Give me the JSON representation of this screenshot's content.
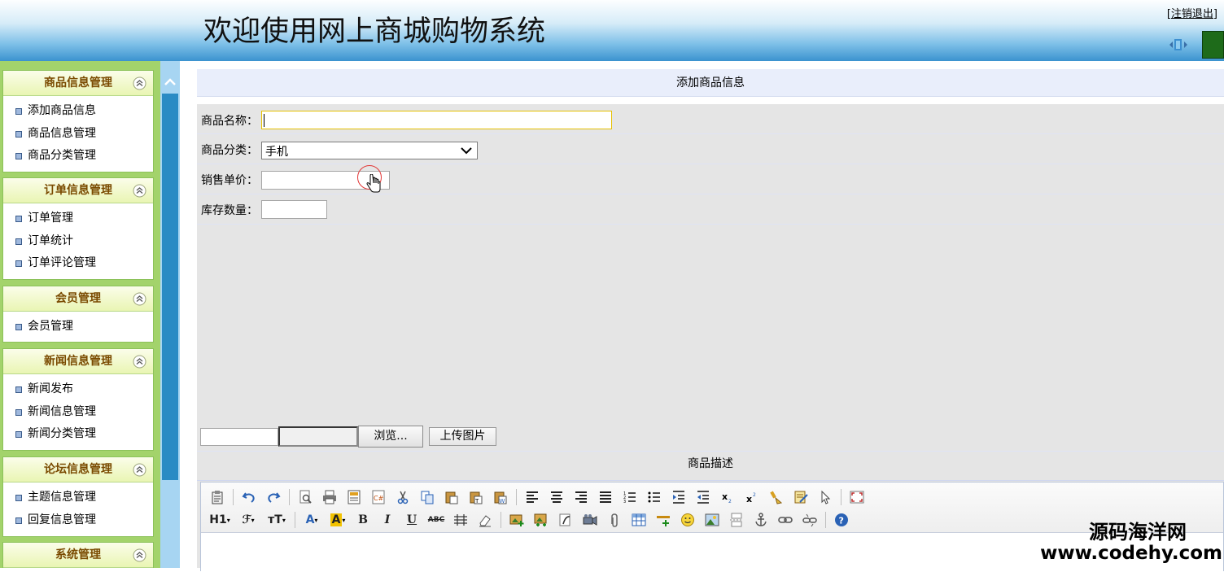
{
  "header": {
    "title": "欢迎使用网上商城购物系统",
    "logout_prefix": "[",
    "logout_label": "注销退出",
    "logout_suffix": "]"
  },
  "sidebar": {
    "groups": [
      {
        "title": "商品信息管理",
        "items": [
          "添加商品信息",
          "商品信息管理",
          "商品分类管理"
        ]
      },
      {
        "title": "订单信息管理",
        "items": [
          "订单管理",
          "订单统计",
          "订单评论管理"
        ]
      },
      {
        "title": "会员管理",
        "items": [
          "会员管理"
        ]
      },
      {
        "title": "新闻信息管理",
        "items": [
          "新闻发布",
          "新闻信息管理",
          "新闻分类管理"
        ]
      },
      {
        "title": "论坛信息管理",
        "items": [
          "主题信息管理",
          "回复信息管理"
        ]
      },
      {
        "title": "系统管理",
        "items": []
      }
    ]
  },
  "form": {
    "title": "添加商品信息",
    "name_label": "商品名称：",
    "name_value": "",
    "category_label": "商品分类：",
    "category_value": "手机",
    "price_label": "销售单价：",
    "price_value": "",
    "stock_label": "库存数量：",
    "stock_value": "",
    "browse_label": "浏览...",
    "upload_label": "上传图片",
    "description_label": "商品描述"
  },
  "editor": {
    "heading_label": "H1",
    "font_label": "ℱ",
    "size_label": "тT",
    "font_color_label": "A",
    "bg_color_label": "A",
    "bold_label": "B",
    "italic_label": "I",
    "underline_label": "U",
    "strike_label": "ABC"
  },
  "watermark": {
    "site_name": "源码海洋网",
    "url": "www.codehy.com"
  },
  "colors": {
    "sidebar_bg": "#a3d36b",
    "menu_head_text": "#7a4a00",
    "splitter_bar": "#2a8bc4",
    "form_bg": "#e5e5e5"
  }
}
